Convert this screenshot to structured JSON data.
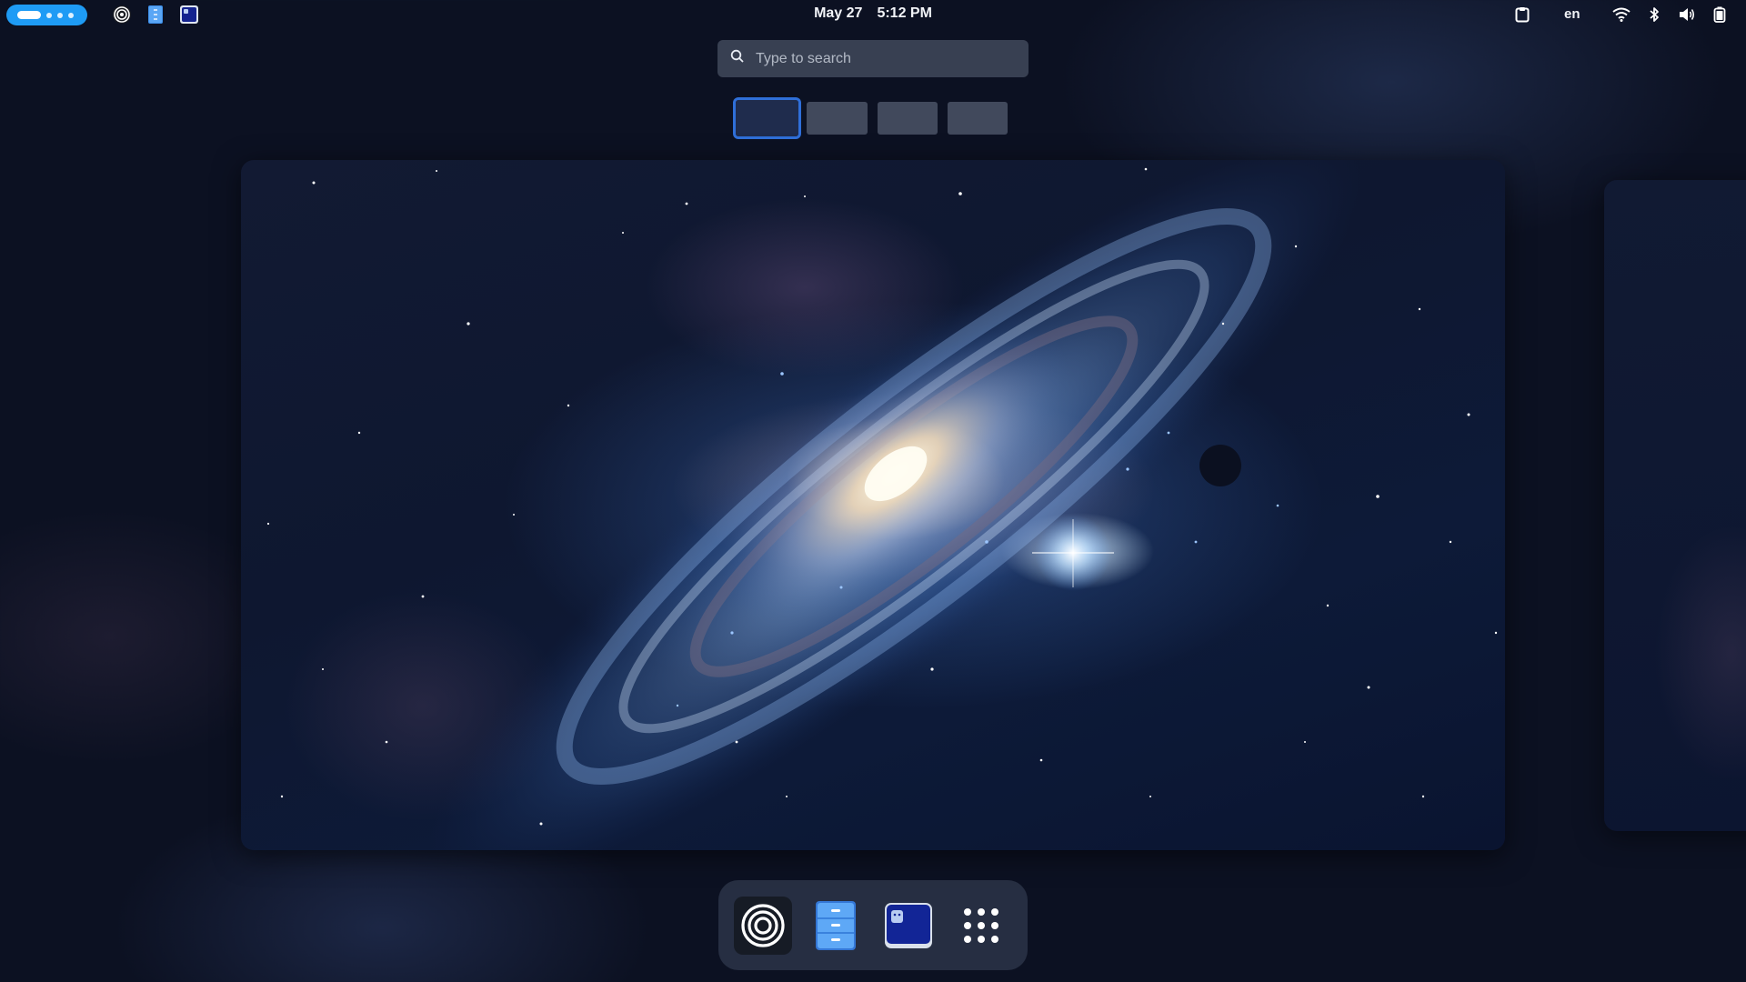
{
  "topbar": {
    "activities_label": "Activities",
    "pinned_apps": [
      "radar-app",
      "files-app",
      "terminal-app"
    ],
    "clock": {
      "date": "May 27",
      "time": "5:12 PM"
    },
    "tray": {
      "clipboard": "clipboard-icon",
      "language": "en",
      "wifi": "wifi-icon",
      "bluetooth": "bluetooth-icon",
      "volume": "volume-icon",
      "battery": "battery-icon"
    }
  },
  "search": {
    "placeholder": "Type to search",
    "value": ""
  },
  "workspaces": {
    "count": 4,
    "active_index": 0
  },
  "wallpaper": {
    "description_icon": "galaxy-wallpaper"
  },
  "dash": {
    "items": [
      "radar-app",
      "files-app",
      "terminal-app",
      "app-grid"
    ]
  },
  "colors": {
    "accent": "#1e9bf5",
    "active_workspace_border": "#2f6fd9",
    "background": "#0c1122"
  }
}
